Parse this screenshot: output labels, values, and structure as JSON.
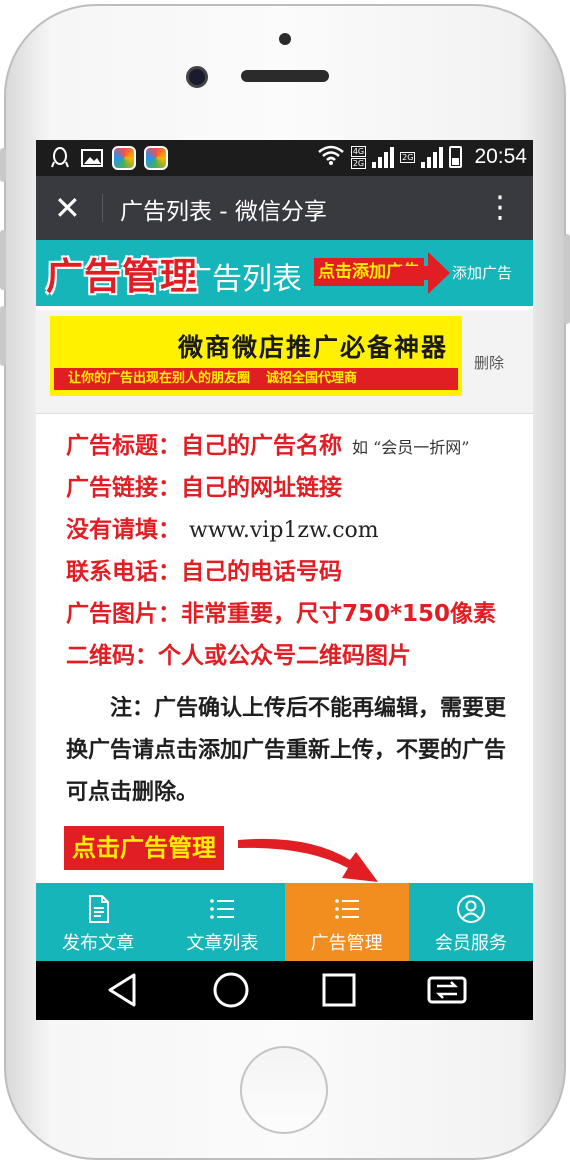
{
  "status_bar": {
    "time": "20:54",
    "net_top": "4G",
    "net_bottom": "2G",
    "net2": "2G",
    "icons": [
      "qq-icon",
      "image-icon",
      "app-icon",
      "app-icon",
      "wifi-icon",
      "signal-icon",
      "battery-icon"
    ]
  },
  "title_bar": {
    "close_symbol": "✕",
    "title": "广告列表 - 微信分享",
    "more_symbol": "⋮"
  },
  "ad_header": {
    "brand": "广告管理",
    "list_title": "广告列表",
    "click_add": "点击添加广告",
    "add_link": "添加广告"
  },
  "ad_item": {
    "banner_main": "微商微店推广必备神器",
    "banner_sub_left": "让你的广告出现在别人的朋友圈",
    "banner_sub_right": "诚招全国代理商",
    "delete_link": "删除"
  },
  "info": {
    "title_line": "广告标题：自己的广告名称",
    "title_example": "如 “会员一折网”",
    "link_line": "广告链接：自己的网址链接",
    "empty_label": "没有请填：",
    "empty_url": "www.vip1zw.com",
    "phone_line": "联系电话：自己的电话号码",
    "image_line": "广告图片：非常重要，尺寸750*150像素",
    "qr_line": "二维码：个人或公众号二维码图片"
  },
  "note": {
    "text": "注：广告确认上传后不能再编辑，需要更换广告请点击添加广告重新上传，不要的广告可点击删除。"
  },
  "manage_tag": "点击广告管理",
  "tabs": [
    {
      "label": "发布文章",
      "icon": "document-icon",
      "active": false
    },
    {
      "label": "文章列表",
      "icon": "list-icon",
      "active": false
    },
    {
      "label": "广告管理",
      "icon": "list-icon",
      "active": true
    },
    {
      "label": "会员服务",
      "icon": "user-icon",
      "active": false
    }
  ],
  "colors": {
    "teal": "#16b5b9",
    "orange": "#f28d20",
    "red": "#e21e25",
    "yellow": "#fff100",
    "titlebar": "#393a3f"
  }
}
